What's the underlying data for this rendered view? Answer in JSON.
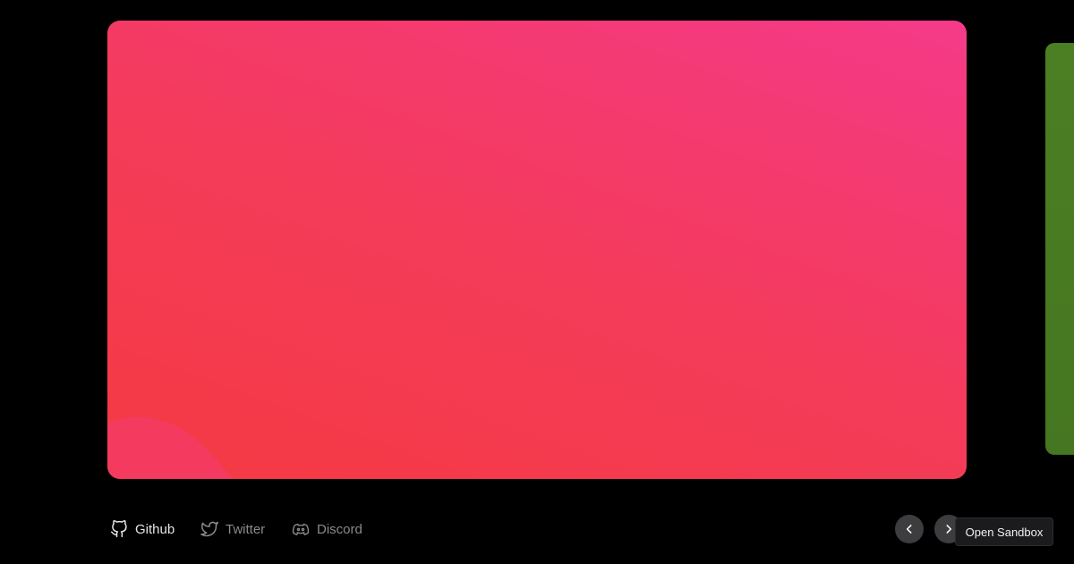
{
  "slides": {
    "current": {
      "gradient_colors": [
        "#f43a42",
        "#f43b58",
        "#f43a70",
        "#f53a8a"
      ],
      "blob_color": "#f43a5e"
    },
    "next": {
      "color": "#4a7a22"
    }
  },
  "footer": {
    "links": [
      {
        "label": "Github",
        "icon": "github-icon",
        "color": "#e6e6e6"
      },
      {
        "label": "Twitter",
        "icon": "twitter-icon",
        "color": "#8a8a8a"
      },
      {
        "label": "Discord",
        "icon": "discord-icon",
        "color": "#8a8a8a"
      }
    ]
  },
  "navigation": {
    "prev_icon": "chevron-left-icon",
    "next_icon": "chevron-right-icon",
    "button_color": "#3d3d40"
  },
  "tooltip": {
    "label": "Open Sandbox"
  }
}
